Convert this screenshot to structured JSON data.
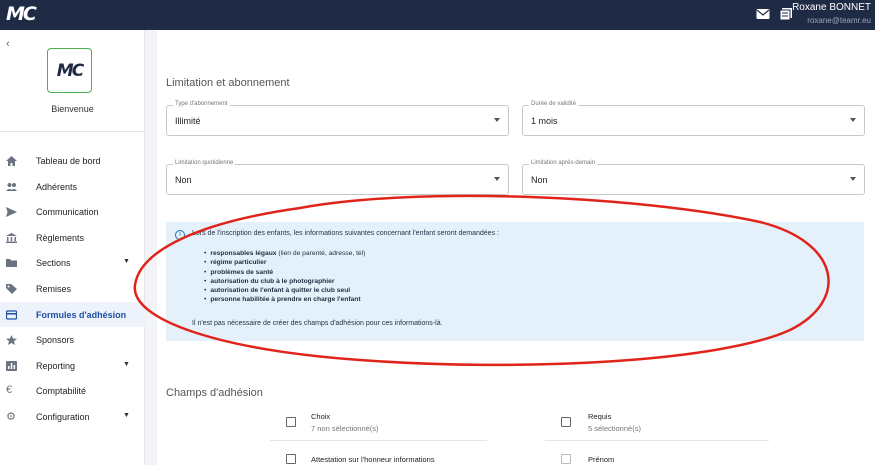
{
  "app": {
    "logo_text": "MC",
    "user_name": "Roxane BONNET",
    "user_email": "roxane@teamr.eu"
  },
  "sidebar": {
    "welcome": "Bienvenue",
    "items": [
      {
        "label": "Tableau de bord",
        "icon": "home-icon"
      },
      {
        "label": "Adhérents",
        "icon": "people-icon"
      },
      {
        "label": "Communication",
        "icon": "send-icon"
      },
      {
        "label": "Règlements",
        "icon": "bank-icon"
      },
      {
        "label": "Sections",
        "icon": "folder-icon",
        "expandable": true
      },
      {
        "label": "Remises",
        "icon": "tag-icon"
      },
      {
        "label": "Formules d'adhésion",
        "icon": "card-icon",
        "active": true
      },
      {
        "label": "Sponsors",
        "icon": "star-icon"
      },
      {
        "label": "Reporting",
        "icon": "chart-icon",
        "expandable": true
      },
      {
        "label": "Comptabilité",
        "icon": "euro-icon"
      },
      {
        "label": "Configuration",
        "icon": "gear-icon",
        "expandable": true
      }
    ]
  },
  "limitation": {
    "title": "Limitation et abonnement",
    "type_label": "Type d'abonnement",
    "type_value": "Illimité",
    "duree_label": "Durée de validité",
    "duree_value": "1 mois",
    "quotidienne_label": "Limitation quotidienne",
    "quotidienne_value": "Non",
    "apres_demain_label": "Limitation après-demain",
    "apres_demain_value": "Non"
  },
  "info": {
    "intro": "Lors de l'inscription des enfants, les informations suivantes concernant l'enfant seront demandées :",
    "items": [
      {
        "bold": "responsables légaux",
        "rest": " (lien de parenté, adresse, tél)"
      },
      {
        "bold": "régime particulier",
        "rest": ""
      },
      {
        "bold": "problèmes de santé",
        "rest": ""
      },
      {
        "bold": "autorisation du club à le photographier",
        "rest": ""
      },
      {
        "bold": "autorisation de l'enfant à quitter le club seul",
        "rest": ""
      },
      {
        "bold": "personne habilitée à prendre en charge l'enfant",
        "rest": ""
      }
    ],
    "footer": "Il n'est pas nécessaire de créer des champs d'adhésion pour ces informations-là."
  },
  "champs": {
    "title": "Champs d'adhésion",
    "choix_label": "Choix",
    "choix_sub": "7 non sélectionné(s)",
    "requis_label": "Requis",
    "requis_sub": "5 sélectionné(s)",
    "left_first": "Attestation sur l'honneur informations",
    "right_first": "Prénom"
  },
  "annotation": {
    "color": "#e0241b"
  }
}
